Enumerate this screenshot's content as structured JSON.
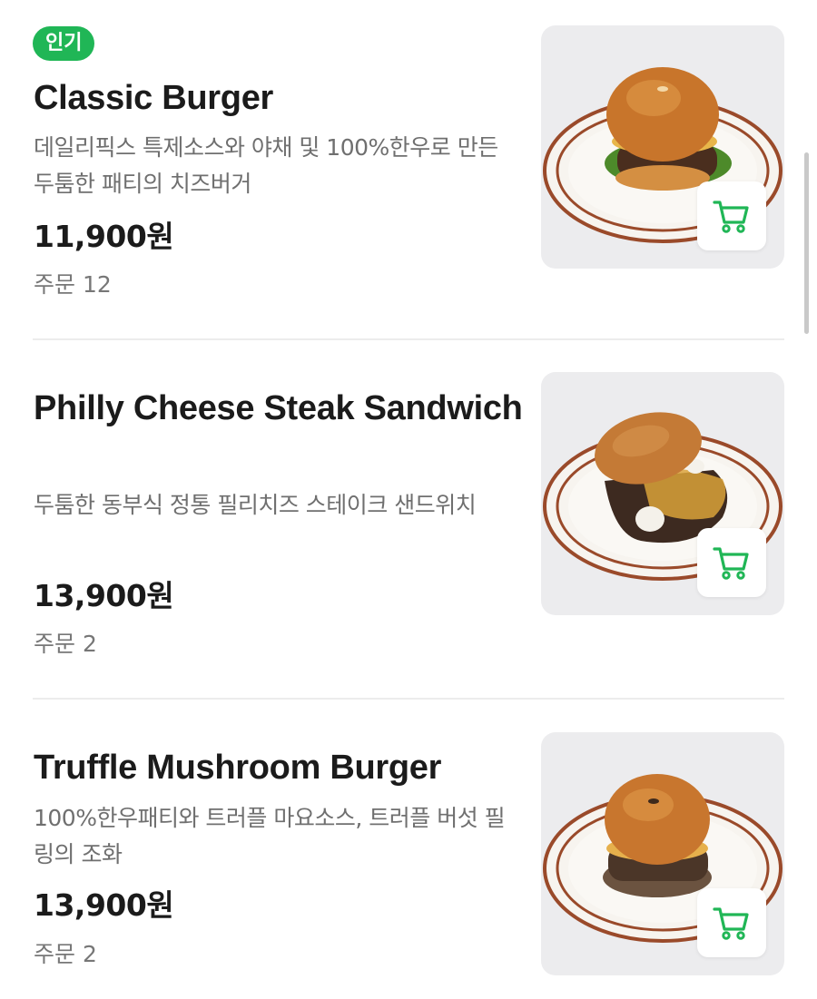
{
  "colors": {
    "accent": "#20b656",
    "badge_text": "#ffffff",
    "thumbnail_bg": "#ececee",
    "divider": "#ececec"
  },
  "menu": {
    "items": [
      {
        "badge": "인기",
        "name": "Classic Burger",
        "description": "데일리픽스 특제소스와 야채 및 100%한우로 만든 두툼한 패티의 치즈버거",
        "price": "11,900원",
        "orders": "주문 12",
        "image_icon": "burger-photo",
        "cart_icon": "cart-icon"
      },
      {
        "name": "Philly Cheese Steak Sandwich",
        "description": "두툼한 동부식 정통 필리치즈 스테이크 샌드위치",
        "price": "13,900원",
        "orders": "주문 2",
        "image_icon": "sandwich-photo",
        "cart_icon": "cart-icon"
      },
      {
        "name": "Truffle Mushroom Burger",
        "description": "100%한우패티와 트러플 마요소스, 트러플 버섯 필링의 조화",
        "price": "13,900원",
        "orders": "주문 2",
        "image_icon": "burger-photo",
        "cart_icon": "cart-icon"
      }
    ]
  }
}
